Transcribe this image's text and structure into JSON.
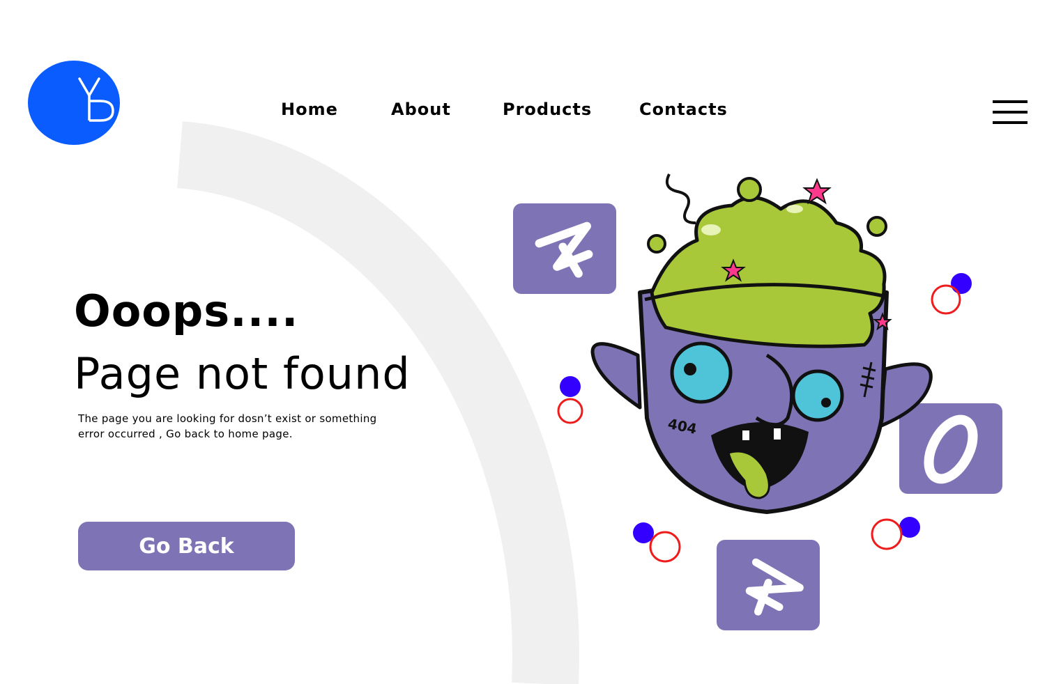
{
  "brand": {
    "logo_text": "YD",
    "logo_color": "#0a5cff"
  },
  "nav": {
    "items": [
      {
        "label": "Home"
      },
      {
        "label": "About"
      },
      {
        "label": "Products"
      },
      {
        "label": "Contacts"
      }
    ]
  },
  "menu": {
    "icon": "hamburger-menu-icon"
  },
  "hero": {
    "headline": "Ooops....",
    "subheadline": "Page not found",
    "description": "The page you are looking for dosn’t exist or something error occurred , Go back to home page.",
    "button_label": "Go Back"
  },
  "illustration": {
    "tiles": [
      "4",
      "0",
      "4"
    ],
    "sticker_text": "404"
  },
  "colors": {
    "accent": "#7e74b5",
    "brand_blue": "#0a5cff",
    "arc": "#f0f0f0",
    "dot_blue": "#3300ff",
    "ring_red": "#ee1c1c",
    "slime": "#a8c83a",
    "star": "#ff3a8c",
    "eye": "#4fc3d8"
  }
}
